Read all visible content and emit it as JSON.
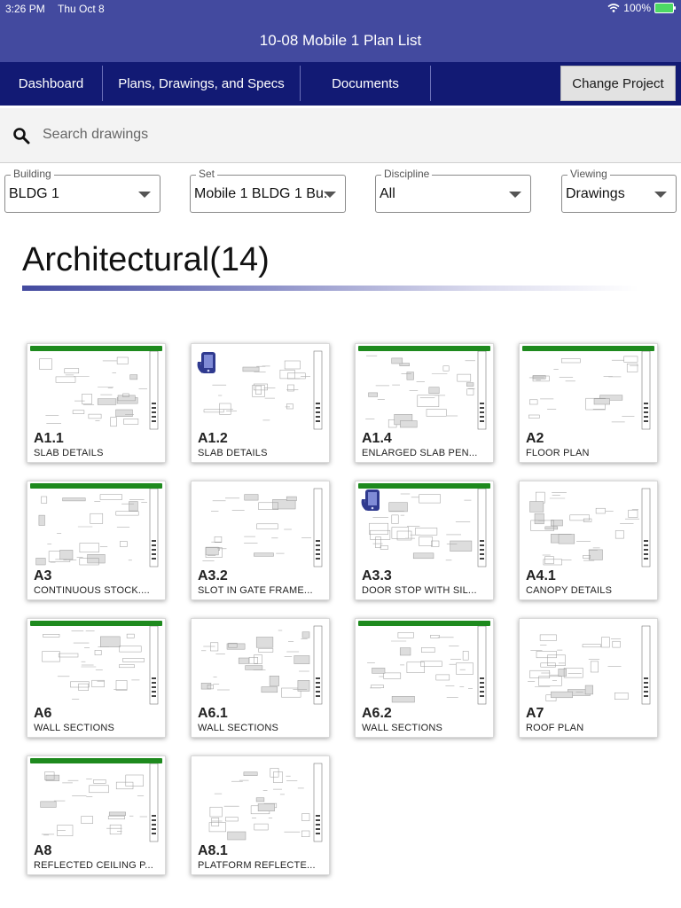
{
  "status": {
    "time": "3:26 PM",
    "date": "Thu Oct 8",
    "battery": "100%"
  },
  "app": {
    "title": "10-08 Mobile 1 Plan List"
  },
  "nav": {
    "dashboard": "Dashboard",
    "plans": "Plans, Drawings, and Specs",
    "documents": "Documents",
    "change_project": "Change Project"
  },
  "search": {
    "placeholder": "Search drawings",
    "value": ""
  },
  "filters": {
    "building": {
      "label": "Building",
      "value": "BLDG 1"
    },
    "set": {
      "label": "Set",
      "value": "Mobile 1 BLDG 1 Bu..."
    },
    "discipline": {
      "label": "Discipline",
      "value": "All"
    },
    "viewing": {
      "label": "Viewing",
      "value": "Drawings"
    }
  },
  "section": {
    "title": "Architectural(14)"
  },
  "colors": {
    "header": "#434a9f",
    "nav": "#121a74",
    "status_bar": "#1e8a1e",
    "badge": "#2f3a8f"
  },
  "drawings": [
    {
      "number": "A1.1",
      "title": "SLAB DETAILS",
      "bar": true,
      "badge": false
    },
    {
      "number": "A1.2",
      "title": "SLAB DETAILS",
      "bar": false,
      "badge": true
    },
    {
      "number": "A1.4",
      "title": "ENLARGED SLAB PEN...",
      "bar": true,
      "badge": false
    },
    {
      "number": "A2",
      "title": "FLOOR PLAN",
      "bar": true,
      "badge": false
    },
    {
      "number": "A3",
      "title": "CONTINUOUS STOCK....",
      "bar": true,
      "badge": false
    },
    {
      "number": "A3.2",
      "title": "SLOT IN GATE FRAME...",
      "bar": false,
      "badge": false
    },
    {
      "number": "A3.3",
      "title": "DOOR STOP WITH SIL...",
      "bar": true,
      "badge": true
    },
    {
      "number": "A4.1",
      "title": "CANOPY DETAILS",
      "bar": false,
      "badge": false
    },
    {
      "number": "A6",
      "title": "WALL SECTIONS",
      "bar": true,
      "badge": false
    },
    {
      "number": "A6.1",
      "title": "WALL SECTIONS",
      "bar": false,
      "badge": false
    },
    {
      "number": "A6.2",
      "title": "WALL SECTIONS",
      "bar": true,
      "badge": false
    },
    {
      "number": "A7",
      "title": "ROOF PLAN",
      "bar": false,
      "badge": false
    },
    {
      "number": "A8",
      "title": "REFLECTED CEILING P...",
      "bar": true,
      "badge": false
    },
    {
      "number": "A8.1",
      "title": "PLATFORM REFLECTE...",
      "bar": false,
      "badge": false
    }
  ]
}
